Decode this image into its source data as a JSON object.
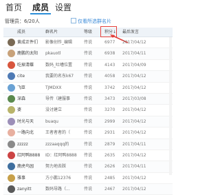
{
  "tabs": [
    {
      "label": "首页",
      "active": false
    },
    {
      "label": "成员",
      "active": true
    },
    {
      "label": "设置",
      "active": false
    }
  ],
  "admins_label": "管理员：6/20人",
  "hint_label": "仅看所选群名片",
  "columns": {
    "name": "成员",
    "card": "群名片",
    "level": "等级",
    "points": "积分",
    "sort_indicator": "↓",
    "last_speak": "最后发言"
  },
  "colors": {
    "accent": "#2a8ed8",
    "highlight": "#e4403b"
  },
  "members": [
    {
      "name": "黄成正件们",
      "card": "影像创作_编辑",
      "level": "传说",
      "points": "6977",
      "date": "2017/04/12",
      "avatar": "#7a6a55"
    },
    {
      "name": "鹿鹏的太阳",
      "card": "pkauotl",
      "level": "传说",
      "points": "6938",
      "date": "2017/04/11",
      "avatar": "#c8a27a"
    },
    {
      "name": "吃掉清蝶",
      "card": "数码_吐嘈位置",
      "level": "传说",
      "points": "4143",
      "date": "2017/04/09",
      "avatar": "#d8563e"
    },
    {
      "name": "cite",
      "card": "我要的名东k67",
      "level": "传说",
      "points": "4058",
      "date": "2017/04/12",
      "avatar": "#4e7ab5"
    },
    {
      "name": "飞臣",
      "card": "TJMDXX",
      "level": "传说",
      "points": "3742",
      "date": "2017/04/12",
      "avatar": "#6aa2d4"
    },
    {
      "name": "深森",
      "card": "导传（建服事",
      "level": "传说",
      "points": "3473",
      "date": "2017/03/08",
      "avatar": "#5b8a4e"
    },
    {
      "name": "婆",
      "card": "没讨建立",
      "level": "传说",
      "points": "3270",
      "date": "2017/04/12",
      "avatar": "#b9b46a"
    },
    {
      "name": "时光与天",
      "card": "buaqu",
      "level": "传说",
      "points": "2999",
      "date": "2017/04/12",
      "avatar": "#9c8fb8"
    },
    {
      "name": "一路向北",
      "card": "王者者者的（",
      "level": "传说",
      "points": "2931",
      "date": "2017/04/12",
      "avatar": "#e8b0a0"
    },
    {
      "name": "zzzzz",
      "card": "zzzaaqqq的",
      "level": "传说",
      "points": "2879",
      "date": "2017/04/11",
      "avatar": "#8a8a8a"
    },
    {
      "name": "红阿鸭8888",
      "card": "ID：红阿鸭8888",
      "level": "传说",
      "points": "2635",
      "date": "2017/04/12",
      "avatar": "#cc4444"
    },
    {
      "name": "鹿虎鸟园",
      "card": "努力地去踩",
      "level": "传说",
      "points": "2626",
      "date": "2017/04/11",
      "avatar": "#3f6f9f"
    },
    {
      "name": "雅事",
      "card": "方小鹏12376",
      "level": "传说",
      "points": "2485",
      "date": "2017/04/12",
      "avatar": "#c7a04a"
    },
    {
      "name": "zanyitt",
      "card": "数码导路（...",
      "level": "传说",
      "points": "2467",
      "date": "2017/04/12",
      "avatar": "#5a5a5a"
    }
  ]
}
